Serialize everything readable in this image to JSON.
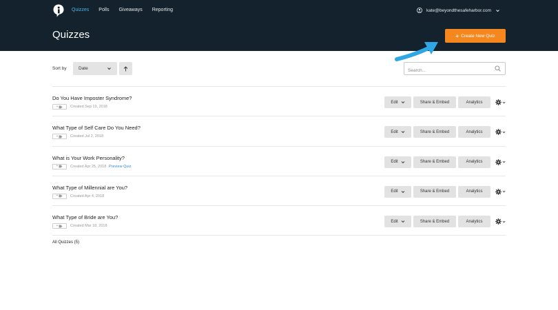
{
  "nav": {
    "items": [
      {
        "label": "Quizzes",
        "active": true
      },
      {
        "label": "Polls",
        "active": false
      },
      {
        "label": "Giveaways",
        "active": false
      },
      {
        "label": "Reporting",
        "active": false
      }
    ],
    "account_email": "kate@beyondthesafeharbor.com"
  },
  "header": {
    "title": "Quizzes",
    "create_label": "Create New Quiz"
  },
  "toolbar": {
    "sort_label": "Sort by",
    "sort_value": "Date",
    "search_placeholder": "Search..."
  },
  "quizzes": [
    {
      "title": "Do You Have Imposter Syndrome?",
      "created": "Created Sep 19, 2018",
      "preview": ""
    },
    {
      "title": "What Type of Self Care Do You Need?",
      "created": "Created Jul 2, 2018",
      "preview": ""
    },
    {
      "title": "What is Your Work Personality?",
      "created": "Created Apr 25, 2018",
      "preview": "Preview Quiz"
    },
    {
      "title": "What Type of Millennial are You?",
      "created": "Created Apr 4, 2018",
      "preview": ""
    },
    {
      "title": "What Type of Bride are You?",
      "created": "Created Mar 18, 2018",
      "preview": ""
    }
  ],
  "row_actions": {
    "edit": "Edit",
    "share": "Share & Embed",
    "analytics": "Analytics",
    "tag_plus": "+"
  },
  "footer": {
    "all_label": "All Quizzes (5)"
  },
  "colors": {
    "topbar": "#14222d",
    "nav_active": "#4fb3e8",
    "create_button": "#f5871f",
    "arrow": "#2fa6e6",
    "link": "#2e8fd6"
  },
  "icons": [
    "logo-icon",
    "user-icon",
    "chevron-down-icon",
    "arrow-up-icon",
    "search-icon",
    "tag-icon",
    "gear-icon",
    "annotation-arrow"
  ]
}
